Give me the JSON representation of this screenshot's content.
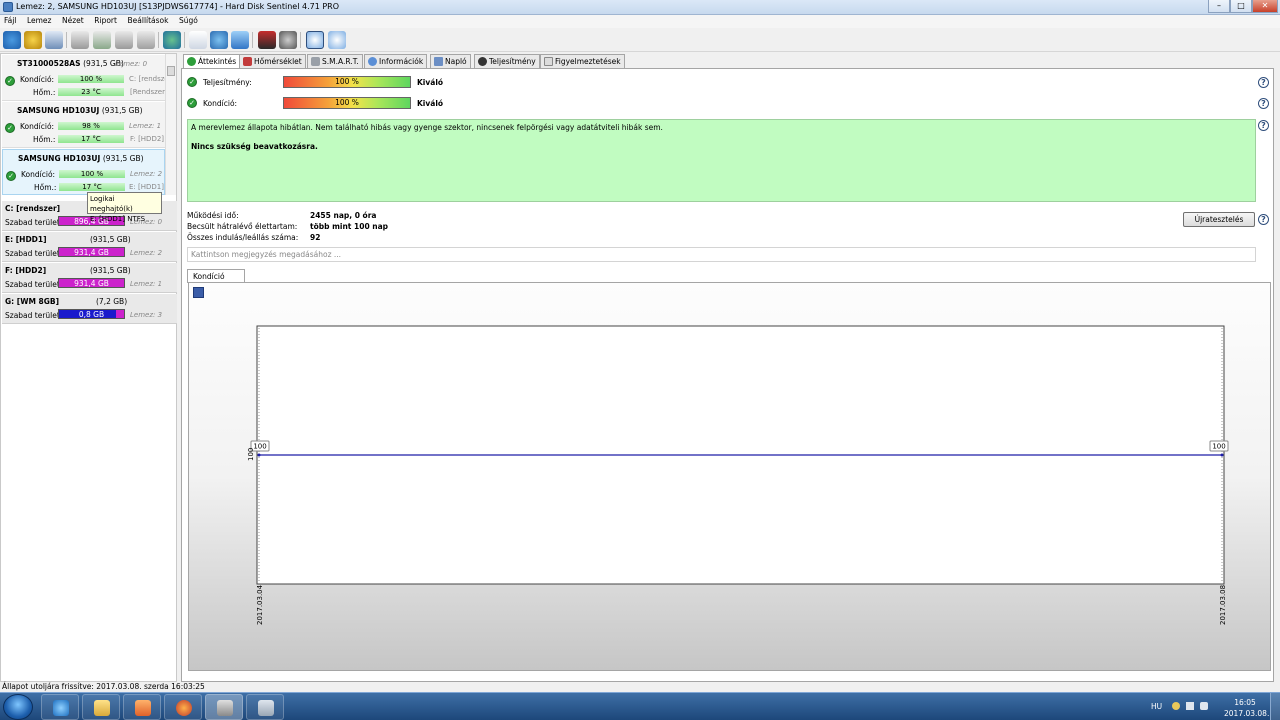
{
  "window": {
    "title": "Lemez: 2, SAMSUNG HD103UJ [S13PJDWS617774]  -  Hard Disk Sentinel 4.71 PRO",
    "min": "–",
    "max": "□",
    "close": "✕"
  },
  "menu": [
    "Fájl",
    "Lemez",
    "Nézet",
    "Riport",
    "Beállítások",
    "Súgó"
  ],
  "disks": [
    {
      "name": "ST31000528AS",
      "size": "(931,5 GB)",
      "sub": "Lemez: 0",
      "cond_label": "Kondíció:",
      "cond": "100 %",
      "cond_pct": 100,
      "vol": "C: [rendszer]",
      "temp_label": "Hőm.:",
      "temp": "23 °C",
      "vol2": "[Rendszer]"
    },
    {
      "name": "SAMSUNG HD103UJ",
      "size": "(931,5 GB)",
      "sub": "",
      "cond_label": "Kondíció:",
      "cond": "98 %",
      "cond_pct": 98,
      "vol": "Lemez: 1",
      "temp_label": "Hőm.:",
      "temp": "17 °C",
      "vol2": "F: [HDD2]"
    },
    {
      "name": "SAMSUNG HD103UJ",
      "size": "(931,5 GB)",
      "sub": "",
      "cond_label": "Kondíció:",
      "cond": "100 %",
      "cond_pct": 100,
      "vol": "Lemez: 2",
      "temp_label": "Hőm.:",
      "temp": "17 °C",
      "vol2": "E: [HDD1]"
    }
  ],
  "tooltip": {
    "line1": "Logikai meghajtó(k)",
    "line2": "E: [HDD1] NTFS"
  },
  "volumes": [
    {
      "name": "C: [rendszer]",
      "size": "",
      "free_label": "Szabad terület",
      "free": "896,4 GB",
      "disk": "Lemez: 0",
      "color": "#cc22cc"
    },
    {
      "name": "E: [HDD1]",
      "size": "(931,5 GB)",
      "free_label": "Szabad terület",
      "free": "931,4 GB",
      "disk": "Lemez: 2",
      "color": "#cc22cc"
    },
    {
      "name": "F: [HDD2]",
      "size": "(931,5 GB)",
      "free_label": "Szabad terület",
      "free": "931,4 GB",
      "disk": "Lemez: 1",
      "color": "#cc22cc"
    },
    {
      "name": "G: [WM 8GB]",
      "size": "(7,2 GB)",
      "free_label": "Szabad terület",
      "free": "0,8 GB",
      "disk": "Lemez: 3",
      "color": "#1a1acc"
    }
  ],
  "tabs": [
    "Áttekintés",
    "Hőmérséklet",
    "S.M.A.R.T.",
    "Információk",
    "Napló",
    "Teljesítmény",
    "Figyelmeztetések"
  ],
  "overview": {
    "perf_label": "Teljesítmény:",
    "perf_value": "100 %",
    "perf_pct": 100,
    "perf_text": "Kiváló",
    "cond_label": "Kondíció:",
    "cond_value": "100 %",
    "cond_pct": 100,
    "cond_text": "Kiváló",
    "message": "A merevlemez állapota hibátlan. Nem található hibás vagy gyenge szektor, nincsenek felpörgési vagy adatátviteli hibák sem.",
    "advice": "Nincs szükség beavatkozásra.",
    "uptime_label": "Működési idő:",
    "uptime": "2455 nap, 0 óra",
    "life_label": "Becsült hátralévő élettartam:",
    "life": "több mint 100 nap",
    "starts_label": "Összes indulás/leállás száma:",
    "starts": "92",
    "retest": "Újratesztelés",
    "note_placeholder": "Kattintson megjegyzés megadásához ...",
    "chart_tab": "Kondíció  (%)",
    "help": "?"
  },
  "chart_data": {
    "type": "line",
    "x": [
      "2017.03.04",
      "2017.03.08"
    ],
    "series": [
      {
        "values": [
          100,
          100
        ]
      }
    ],
    "point_labels": [
      "100",
      "100"
    ],
    "ytick": "100",
    "line_color": "#1e1ea8"
  },
  "status": "Állapot utoljára frissítve: 2017.03.08. szerda 16:03:25",
  "tray": {
    "lang": "HU",
    "time": "16:05",
    "date": "2017.03.08."
  }
}
